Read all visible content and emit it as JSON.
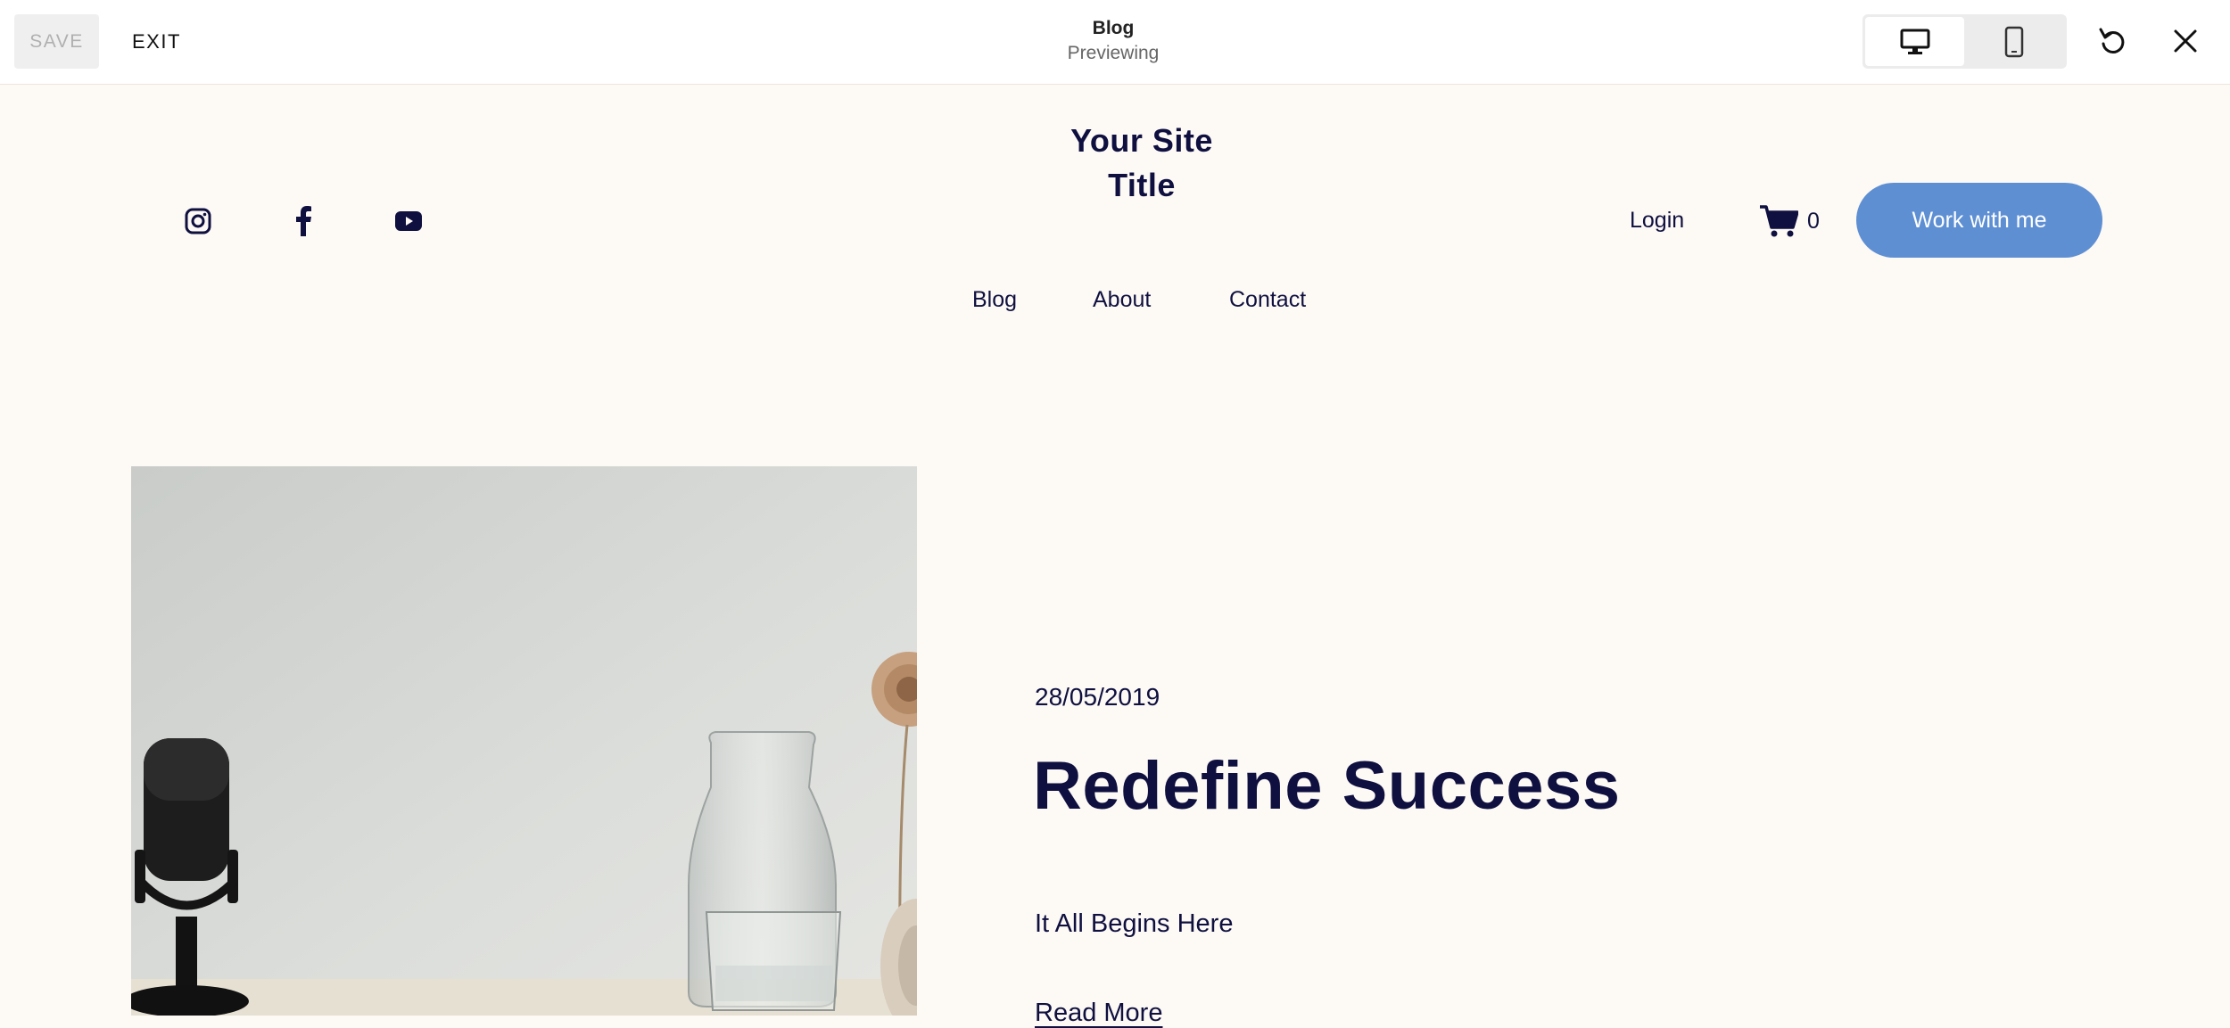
{
  "toolbar": {
    "save_label": "SAVE",
    "exit_label": "EXIT",
    "page_title": "Blog",
    "page_status": "Previewing",
    "devices": [
      "desktop-icon",
      "mobile-icon"
    ],
    "active_device": "desktop",
    "icons": [
      "undo-icon",
      "close-icon"
    ]
  },
  "site": {
    "title_line1": "Your Site",
    "title_line2": "Title",
    "social_icons": [
      "instagram-icon",
      "facebook-icon",
      "youtube-icon"
    ],
    "nav": [
      "Blog",
      "About",
      "Contact"
    ],
    "login_label": "Login",
    "cart_count": "0",
    "cta_label": "Work with me",
    "accent_color": "#5e8fd3",
    "text_color": "#0f1040",
    "background_color": "#fdf9f4"
  },
  "post": {
    "date": "28/05/2019",
    "title": "Redefine Success",
    "excerpt": "It All Begins Here",
    "read_more": "Read More"
  }
}
